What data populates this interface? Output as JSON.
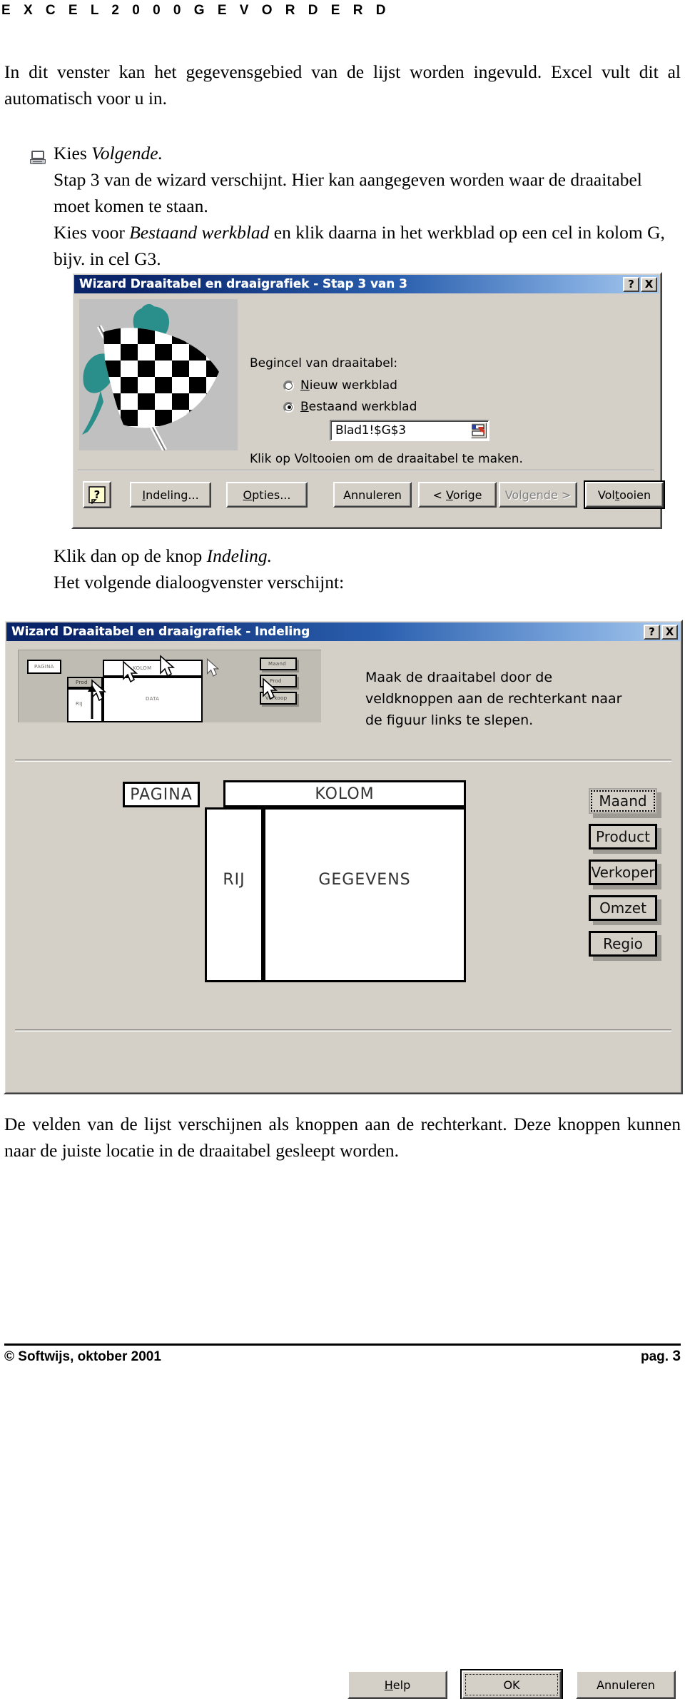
{
  "header": {
    "title": "E X C E L   2 0 0 0   G E V O R D E R D"
  },
  "intro": {
    "text": "In dit venster kan het gegevensgebied van de lijst worden ingevuld. Excel vult dit al automatisch voor u in."
  },
  "steps": {
    "line1_pre": "Kies ",
    "line1_italic": "Volgende.",
    "line2": "Stap 3 van de wizard verschijnt. Hier kan aangegeven worden waar de draaitabel moet komen te staan.",
    "line3_pre": "Kies voor ",
    "line3_italic": "Bestaand werkblad",
    "line3_post": " en klik daarna in het werkblad op een cel in kolom G, bijv. in cel G3."
  },
  "mid_text": {
    "line1_pre": "Klik dan op de knop ",
    "line1_italic": "Indeling.",
    "line2": "Het volgende dialoogvenster verschijnt:"
  },
  "closing": {
    "text": "De velden van de lijst verschijnen als knoppen aan de rechterkant. Deze knoppen kunnen naar de juiste locatie in de draaitabel gesleept worden."
  },
  "footer": {
    "copyright": "© Softwijs, oktober 2001",
    "page_label": "pag.",
    "page_number": "3"
  },
  "dialog_step3": {
    "title": "Wizard Draaitabel en draaigrafiek - Stap 3 van 3",
    "help_button": "?",
    "close_button": "X",
    "group_label": "Begincel van draaitabel:",
    "radio_new": "Nieuw werkblad",
    "radio_existing": "Bestaand werkblad",
    "radio_selected": "Bestaand werkblad",
    "reference_value": "Blad1!$G$3",
    "hint": "Klik op Voltooien om de draaitabel te maken.",
    "buttons": {
      "help": "?",
      "indeling": "Indeling...",
      "opties": "Opties...",
      "annuleren": "Annuleren",
      "vorige": "< Vorige",
      "volgende": "Volgende >",
      "voltooien": "Voltooien"
    },
    "volgende_disabled": true
  },
  "dialog_indeling": {
    "title": "Wizard Draaitabel en draaigrafiek - Indeling",
    "help_button": "?",
    "close_button": "X",
    "instruction": "Maak de draaitabel door de\nveldknoppen aan de rechterkant naar\nde figuur links te slepen.",
    "layout": {
      "page": "PAGINA",
      "column": "KOLOM",
      "row": "RIJ",
      "data": "GEGEVENS"
    },
    "fields": [
      {
        "label": "Maand",
        "selected": true
      },
      {
        "label": "Product",
        "selected": false
      },
      {
        "label": "Verkoper",
        "selected": false
      },
      {
        "label": "Omzet",
        "selected": false
      },
      {
        "label": "Regio",
        "selected": false
      }
    ],
    "buttons": {
      "help": "Help",
      "ok": "OK",
      "annuleren": "Annuleren"
    },
    "thumbnail": {
      "page": "PAGINA",
      "column": "KOLOM",
      "row": "RIJ",
      "data": "DATA",
      "drag_label": "Prod",
      "side_buttons": [
        "Maand",
        "Prod",
        "Verkoop"
      ]
    }
  }
}
